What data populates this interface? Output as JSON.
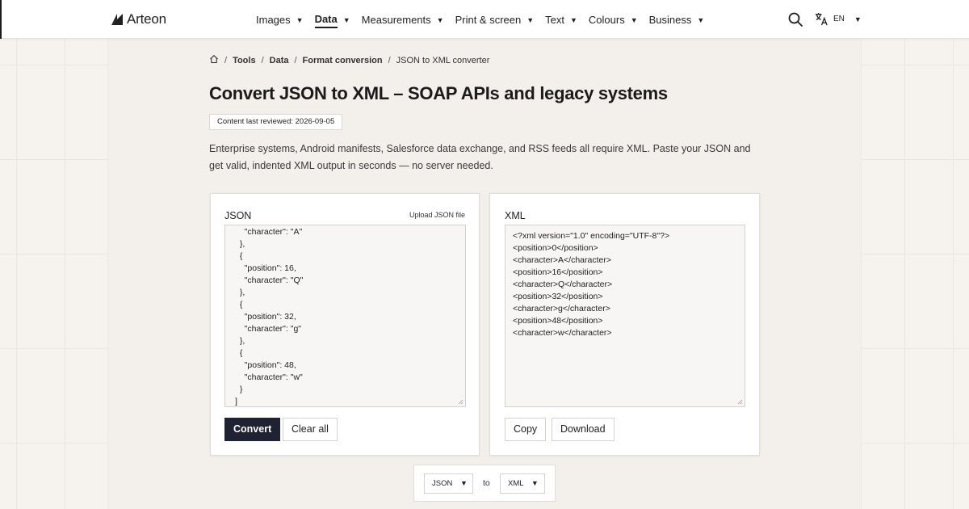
{
  "brand": {
    "name": "Arteon"
  },
  "nav": {
    "items": [
      {
        "label": "Images",
        "active": false
      },
      {
        "label": "Data",
        "active": true
      },
      {
        "label": "Measurements",
        "active": false
      },
      {
        "label": "Print & screen",
        "active": false
      },
      {
        "label": "Text",
        "active": false
      },
      {
        "label": "Colours",
        "active": false
      },
      {
        "label": "Business",
        "active": false
      }
    ],
    "caret": "▼",
    "search_icon": "search-icon",
    "language": {
      "code": "EN",
      "icon": "translate-icon"
    }
  },
  "breadcrumb": {
    "home_icon": "home-icon",
    "separator": "/",
    "items": [
      "Tools",
      "Data",
      "Format conversion"
    ],
    "current": "JSON to XML converter"
  },
  "page": {
    "title": "Convert JSON to XML – SOAP APIs and legacy systems",
    "reviewed": "Content last reviewed: 2026-09-05",
    "intro": "Enterprise systems, Android manifests, Salesforce data exchange, and RSS feeds all require XML. Paste your JSON and get valid, indented XML output in seconds — no server needed."
  },
  "json_panel": {
    "label": "JSON",
    "upload_link": "Upload JSON file",
    "content": "    \"character\": \"A\"\n  },\n  {\n    \"position\": 16,\n    \"character\": \"Q\"\n  },\n  {\n    \"position\": 32,\n    \"character\": \"g\"\n  },\n  {\n    \"position\": 48,\n    \"character\": \"w\"\n  }\n]",
    "convert_label": "Convert",
    "clear_label": "Clear all"
  },
  "xml_panel": {
    "label": "XML",
    "content": "<?xml version=\"1.0\" encoding=\"UTF-8\"?>\n<position>0</position>\n<character>A</character>\n<position>16</position>\n<character>Q</character>\n<position>32</position>\n<character>g</character>\n<position>48</position>\n<character>w</character>",
    "copy_label": "Copy",
    "download_label": "Download"
  },
  "format_bar": {
    "from": "JSON",
    "to_label": "to",
    "to": "XML"
  },
  "colors": {
    "primary_button": "#1f2233",
    "page_background": "#f6f2ee",
    "panel_background": "#f3efeb"
  }
}
